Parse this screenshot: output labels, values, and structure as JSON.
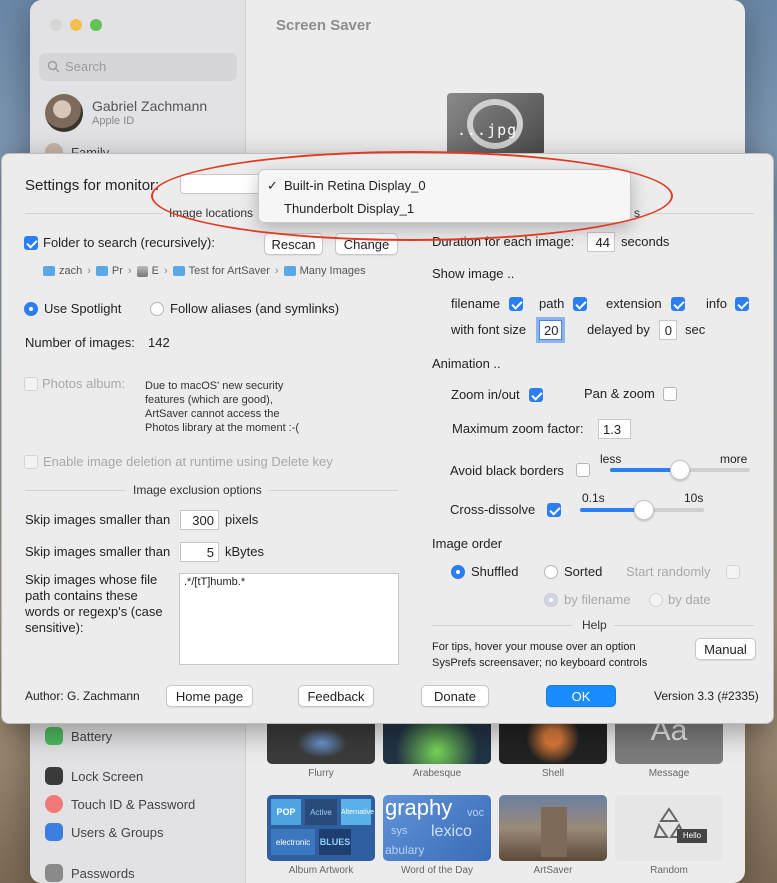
{
  "background_window": {
    "title": "Screen Saver",
    "search_placeholder": "Search",
    "user_name": "Gabriel Zachmann",
    "user_sub": "Apple ID",
    "family": "Family",
    "preview_text": "...jpg",
    "sidebar_items": [
      "Battery",
      "Lock Screen",
      "Touch ID & Password",
      "Users & Groups",
      "Passwords"
    ],
    "thumbnails_row1": [
      "Flurry",
      "Arabesque",
      "Shell",
      "Message"
    ],
    "thumbnails_row2": [
      "Album Artwork",
      "Word of the Day",
      "ArtSaver",
      "Random"
    ],
    "message_thumb_text": "Aa",
    "word_thumb_text": "graphy",
    "word_thumb_text2": "lexico",
    "word_thumb_text3": "abulary",
    "word_thumb_text4": "voc",
    "word_thumb_text5": "sys",
    "album_thumb_words": [
      "POP",
      "Active",
      "electronic",
      "BLUES",
      "Alternative"
    ],
    "random_thumb_text": "Hello"
  },
  "dialog": {
    "settings_for_monitor": "Settings for monitor:",
    "monitor_menu": {
      "items": [
        "Built-in Retina Display_0",
        "Thunderbolt Display_1"
      ],
      "selected_index": 0,
      "checkmark": "✓"
    },
    "image_locations_header": "Image locations",
    "right_header_tail": "s",
    "folder_to_search": "Folder to search (recursively):",
    "rescan": "Rescan",
    "change": "Change",
    "path": [
      "zach",
      "Pr",
      "E",
      "Test for ArtSaver",
      "Many Images"
    ],
    "use_spotlight": "Use Spotlight",
    "follow_aliases": "Follow aliases (and symlinks)",
    "number_of_images_label": "Number of images:",
    "number_of_images": "142",
    "photos_album": "Photos album:",
    "photos_note_1": "Due to macOS' new security",
    "photos_note_2": "features (which are good),",
    "photos_note_3": "ArtSaver cannot access the",
    "photos_note_4": "Photos library at the moment :-(",
    "enable_deletion": "Enable image deletion at runtime using Delete key",
    "exclusion_header": "Image exclusion options",
    "skip_smaller_than_1": "Skip images smaller than",
    "skip_pixels_value": "300",
    "pixels_unit": "pixels",
    "skip_smaller_than_2": "Skip images smaller than",
    "skip_kbytes_value": "5",
    "kbytes_unit": "kBytes",
    "skip_regex_line1": "Skip images whose file",
    "skip_regex_line2": "path contains these",
    "skip_regex_line3": "words or regexp's (case",
    "skip_regex_line4": "sensitive):",
    "regex_value": ".*/[tT]humb.*",
    "duration_label": "Duration for each image:",
    "duration_value": "44",
    "duration_unit": "seconds",
    "show_image": "Show image ..",
    "opt_filename": "filename",
    "opt_path": "path",
    "opt_extension": "extension",
    "opt_info": "info",
    "font_size_label": "with font size",
    "font_size_value": "20",
    "delayed_by_label": "delayed by",
    "delayed_by_value": "0",
    "delayed_unit": "sec",
    "animation": "Animation ..",
    "zoom_in_out": "Zoom in/out",
    "pan_zoom": "Pan & zoom",
    "max_zoom_label": "Maximum zoom factor:",
    "max_zoom_value": "1.3",
    "avoid_black_borders": "Avoid black borders",
    "slider_less": "less",
    "slider_more": "more",
    "avoid_slider_value": 0.5,
    "cross_dissolve": "Cross-dissolve",
    "dissolve_min": "0.1s",
    "dissolve_max": "10s",
    "dissolve_slider_value": 0.52,
    "image_order": "Image order",
    "shuffled": "Shuffled",
    "sorted": "Sorted",
    "start_randomly": "Start randomly",
    "by_filename": "by filename",
    "by_date": "by date",
    "help_header": "Help",
    "help_line1": "For tips, hover your mouse over an option",
    "help_line2": "SysPrefs screensaver; no keyboard controls",
    "manual": "Manual",
    "author": "Author: G. Zachmann",
    "home_page": "Home page",
    "feedback": "Feedback",
    "donate": "Donate",
    "ok": "OK",
    "version": "Version 3.3 (#2335)"
  },
  "colors": {
    "accent": "#2b7ff2",
    "annotation": "#e23a22"
  }
}
